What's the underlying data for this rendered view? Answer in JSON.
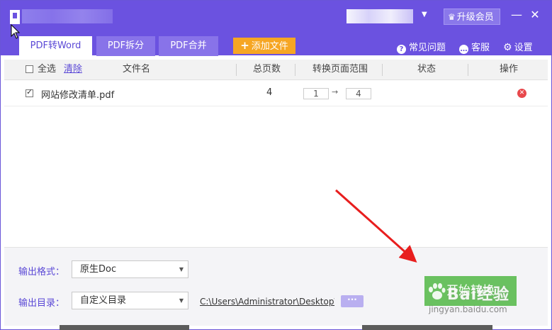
{
  "window": {
    "controls": {
      "minimize": "—",
      "close": "✕"
    }
  },
  "account": {
    "upgrade_label": "升级会员"
  },
  "tabs": [
    {
      "label": "PDF转Word",
      "active": true
    },
    {
      "label": "PDF拆分",
      "active": false
    },
    {
      "label": "PDF合并",
      "active": false
    }
  ],
  "toolbar": {
    "add_file_label": "添加文件",
    "faq_label": "常见问题",
    "service_label": "客服",
    "settings_label": "设置"
  },
  "table": {
    "select_all_label": "全选",
    "clear_label": "清除",
    "columns": {
      "filename": "文件名",
      "pages": "总页数",
      "range": "转换页面范围",
      "status": "状态",
      "action": "操作"
    },
    "rows": [
      {
        "checked": true,
        "filename": "网站修改清单.pdf",
        "pages": "4",
        "range_from": "1",
        "range_to": "4",
        "status": ""
      }
    ]
  },
  "output": {
    "format_label": "输出格式：",
    "format_value": "原生Doc",
    "dir_label": "输出目录：",
    "dir_value": "自定义目录",
    "path": "C:\\Users\\Administrator\\Desktop\\",
    "browse_label": "···"
  },
  "start_button_label": "开始转换",
  "watermark": {
    "text": "Bai经验",
    "url": "jingyan.baidu.com"
  },
  "colors": {
    "brand": "#6b52e0",
    "accent_orange": "#f6a623",
    "start_green": "#6ac160",
    "delete_red": "#e8484c"
  }
}
